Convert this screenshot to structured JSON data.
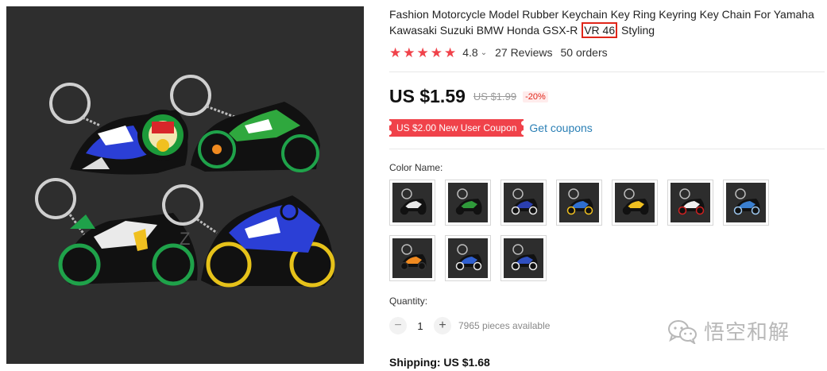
{
  "product": {
    "title_before": "Fashion Motorcycle Model Rubber Keychain Key Ring Keyring Key Chain For Yamaha Kawasaki Suzuki BMW Honda GSX-R ",
    "title_highlight": "VR 46",
    "title_after": " Styling",
    "image_watermark": "Z"
  },
  "rating": {
    "stars": 5,
    "value": "4.8",
    "reviews": "27 Reviews",
    "orders": "50 orders",
    "star_color": "#f0424a"
  },
  "pricing": {
    "price": "US $1.59",
    "original": "US $1.99",
    "discount": "-20%"
  },
  "coupon": {
    "label": "US $2.00 New User Coupon",
    "link": "Get coupons"
  },
  "options": {
    "color_label": "Color Name:",
    "swatches": [
      {
        "bike": "#e8e8e8",
        "accent": "#111111"
      },
      {
        "bike": "#2f9a3a",
        "accent": "#111111"
      },
      {
        "bike": "#2b3fb0",
        "accent": "#e8e8e8"
      },
      {
        "bike": "#2f6fd0",
        "accent": "#f0c020"
      },
      {
        "bike": "#f0c020",
        "accent": "#111111"
      },
      {
        "bike": "#f0f0f0",
        "accent": "#d02020"
      },
      {
        "bike": "#3a7fd0",
        "accent": "#9ec8f0"
      },
      {
        "bike": "#f08a20",
        "accent": "#333333"
      },
      {
        "bike": "#2f5fd0",
        "accent": "#e8e8e8"
      },
      {
        "bike": "#3050c0",
        "accent": "#f0f0f0"
      }
    ]
  },
  "quantity": {
    "label": "Quantity:",
    "minus": "−",
    "value": "1",
    "plus": "+",
    "available": "7965 pieces available"
  },
  "shipping": {
    "label": "Shipping: US $1.68"
  },
  "watermark": {
    "text": "悟空和解",
    "icon": "wechat-icon"
  }
}
